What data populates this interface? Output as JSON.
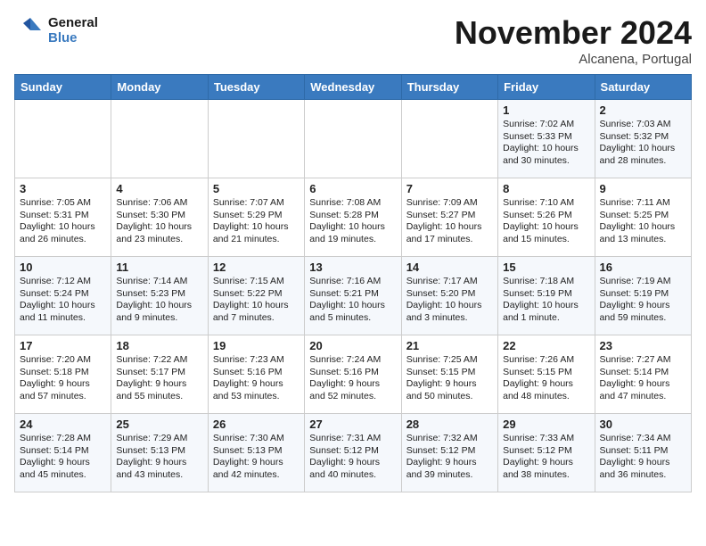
{
  "header": {
    "logo_line1": "General",
    "logo_line2": "Blue",
    "month": "November 2024",
    "location": "Alcanena, Portugal"
  },
  "days_of_week": [
    "Sunday",
    "Monday",
    "Tuesday",
    "Wednesday",
    "Thursday",
    "Friday",
    "Saturday"
  ],
  "weeks": [
    [
      {
        "day": "",
        "info": ""
      },
      {
        "day": "",
        "info": ""
      },
      {
        "day": "",
        "info": ""
      },
      {
        "day": "",
        "info": ""
      },
      {
        "day": "",
        "info": ""
      },
      {
        "day": "1",
        "info": "Sunrise: 7:02 AM\nSunset: 5:33 PM\nDaylight: 10 hours and 30 minutes."
      },
      {
        "day": "2",
        "info": "Sunrise: 7:03 AM\nSunset: 5:32 PM\nDaylight: 10 hours and 28 minutes."
      }
    ],
    [
      {
        "day": "3",
        "info": "Sunrise: 7:05 AM\nSunset: 5:31 PM\nDaylight: 10 hours and 26 minutes."
      },
      {
        "day": "4",
        "info": "Sunrise: 7:06 AM\nSunset: 5:30 PM\nDaylight: 10 hours and 23 minutes."
      },
      {
        "day": "5",
        "info": "Sunrise: 7:07 AM\nSunset: 5:29 PM\nDaylight: 10 hours and 21 minutes."
      },
      {
        "day": "6",
        "info": "Sunrise: 7:08 AM\nSunset: 5:28 PM\nDaylight: 10 hours and 19 minutes."
      },
      {
        "day": "7",
        "info": "Sunrise: 7:09 AM\nSunset: 5:27 PM\nDaylight: 10 hours and 17 minutes."
      },
      {
        "day": "8",
        "info": "Sunrise: 7:10 AM\nSunset: 5:26 PM\nDaylight: 10 hours and 15 minutes."
      },
      {
        "day": "9",
        "info": "Sunrise: 7:11 AM\nSunset: 5:25 PM\nDaylight: 10 hours and 13 minutes."
      }
    ],
    [
      {
        "day": "10",
        "info": "Sunrise: 7:12 AM\nSunset: 5:24 PM\nDaylight: 10 hours and 11 minutes."
      },
      {
        "day": "11",
        "info": "Sunrise: 7:14 AM\nSunset: 5:23 PM\nDaylight: 10 hours and 9 minutes."
      },
      {
        "day": "12",
        "info": "Sunrise: 7:15 AM\nSunset: 5:22 PM\nDaylight: 10 hours and 7 minutes."
      },
      {
        "day": "13",
        "info": "Sunrise: 7:16 AM\nSunset: 5:21 PM\nDaylight: 10 hours and 5 minutes."
      },
      {
        "day": "14",
        "info": "Sunrise: 7:17 AM\nSunset: 5:20 PM\nDaylight: 10 hours and 3 minutes."
      },
      {
        "day": "15",
        "info": "Sunrise: 7:18 AM\nSunset: 5:19 PM\nDaylight: 10 hours and 1 minute."
      },
      {
        "day": "16",
        "info": "Sunrise: 7:19 AM\nSunset: 5:19 PM\nDaylight: 9 hours and 59 minutes."
      }
    ],
    [
      {
        "day": "17",
        "info": "Sunrise: 7:20 AM\nSunset: 5:18 PM\nDaylight: 9 hours and 57 minutes."
      },
      {
        "day": "18",
        "info": "Sunrise: 7:22 AM\nSunset: 5:17 PM\nDaylight: 9 hours and 55 minutes."
      },
      {
        "day": "19",
        "info": "Sunrise: 7:23 AM\nSunset: 5:16 PM\nDaylight: 9 hours and 53 minutes."
      },
      {
        "day": "20",
        "info": "Sunrise: 7:24 AM\nSunset: 5:16 PM\nDaylight: 9 hours and 52 minutes."
      },
      {
        "day": "21",
        "info": "Sunrise: 7:25 AM\nSunset: 5:15 PM\nDaylight: 9 hours and 50 minutes."
      },
      {
        "day": "22",
        "info": "Sunrise: 7:26 AM\nSunset: 5:15 PM\nDaylight: 9 hours and 48 minutes."
      },
      {
        "day": "23",
        "info": "Sunrise: 7:27 AM\nSunset: 5:14 PM\nDaylight: 9 hours and 47 minutes."
      }
    ],
    [
      {
        "day": "24",
        "info": "Sunrise: 7:28 AM\nSunset: 5:14 PM\nDaylight: 9 hours and 45 minutes."
      },
      {
        "day": "25",
        "info": "Sunrise: 7:29 AM\nSunset: 5:13 PM\nDaylight: 9 hours and 43 minutes."
      },
      {
        "day": "26",
        "info": "Sunrise: 7:30 AM\nSunset: 5:13 PM\nDaylight: 9 hours and 42 minutes."
      },
      {
        "day": "27",
        "info": "Sunrise: 7:31 AM\nSunset: 5:12 PM\nDaylight: 9 hours and 40 minutes."
      },
      {
        "day": "28",
        "info": "Sunrise: 7:32 AM\nSunset: 5:12 PM\nDaylight: 9 hours and 39 minutes."
      },
      {
        "day": "29",
        "info": "Sunrise: 7:33 AM\nSunset: 5:12 PM\nDaylight: 9 hours and 38 minutes."
      },
      {
        "day": "30",
        "info": "Sunrise: 7:34 AM\nSunset: 5:11 PM\nDaylight: 9 hours and 36 minutes."
      }
    ]
  ]
}
